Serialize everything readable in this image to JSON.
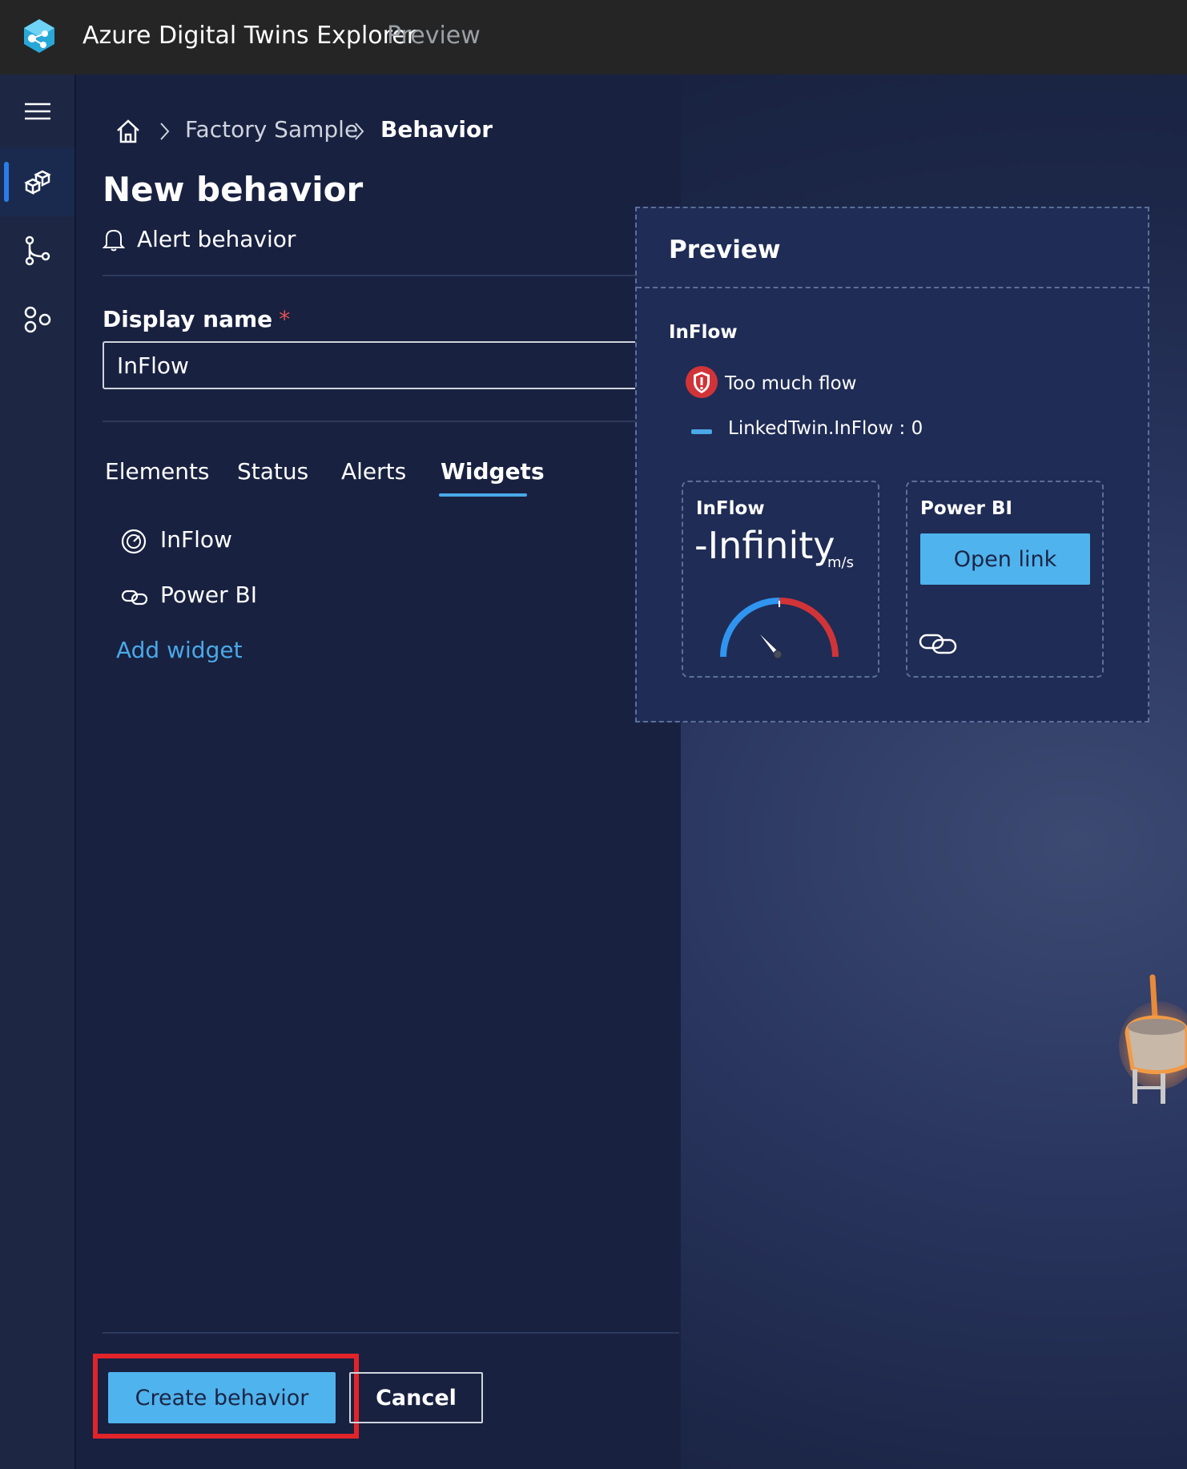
{
  "app": {
    "title": "Azure Digital Twins Explorer",
    "badge": "Preview",
    "icons": {
      "logo": "adt-logo-icon"
    }
  },
  "sidebar": {
    "items": [
      {
        "icon": "hamburger-menu-icon",
        "active": false
      },
      {
        "icon": "scene-builder-icon",
        "active": true
      },
      {
        "icon": "data-history-icon",
        "active": false
      },
      {
        "icon": "models-icon",
        "active": false
      }
    ],
    "accent_color": "#2b7de9"
  },
  "breadcrumb": {
    "home_icon": "home-icon",
    "items": [
      "Factory Sample",
      "Behavior"
    ]
  },
  "page": {
    "title": "New behavior",
    "behavior_type": "Alert behavior",
    "behavior_type_icon": "bell-icon"
  },
  "form": {
    "display_name_label": "Display name",
    "required_marker": "*",
    "display_name_value": "InFlow"
  },
  "tabs": {
    "items": [
      "Elements",
      "Status",
      "Alerts",
      "Widgets"
    ],
    "active": "Widgets"
  },
  "widgets": {
    "items": [
      {
        "label": "InFlow",
        "icon": "gauge-icon"
      },
      {
        "label": "Power BI",
        "icon": "link-icon"
      }
    ],
    "add_label": "Add widget"
  },
  "preview": {
    "title": "Preview",
    "twin_name": "InFlow",
    "alert_text": "Too much flow",
    "alert_icon": "shield-alert-icon",
    "status_text": "LinkedTwin.InFlow : 0",
    "gauge_card": {
      "title": "InFlow",
      "value": "-Infinity",
      "unit": "m/s"
    },
    "link_card": {
      "title": "Power BI",
      "button_label": "Open link"
    }
  },
  "footer": {
    "primary_label": "Create behavior",
    "secondary_label": "Cancel"
  },
  "colors": {
    "accent": "#4fb3ed",
    "link": "#4aa8e8",
    "alert_red": "#d13438",
    "highlight": "#e0242a"
  }
}
